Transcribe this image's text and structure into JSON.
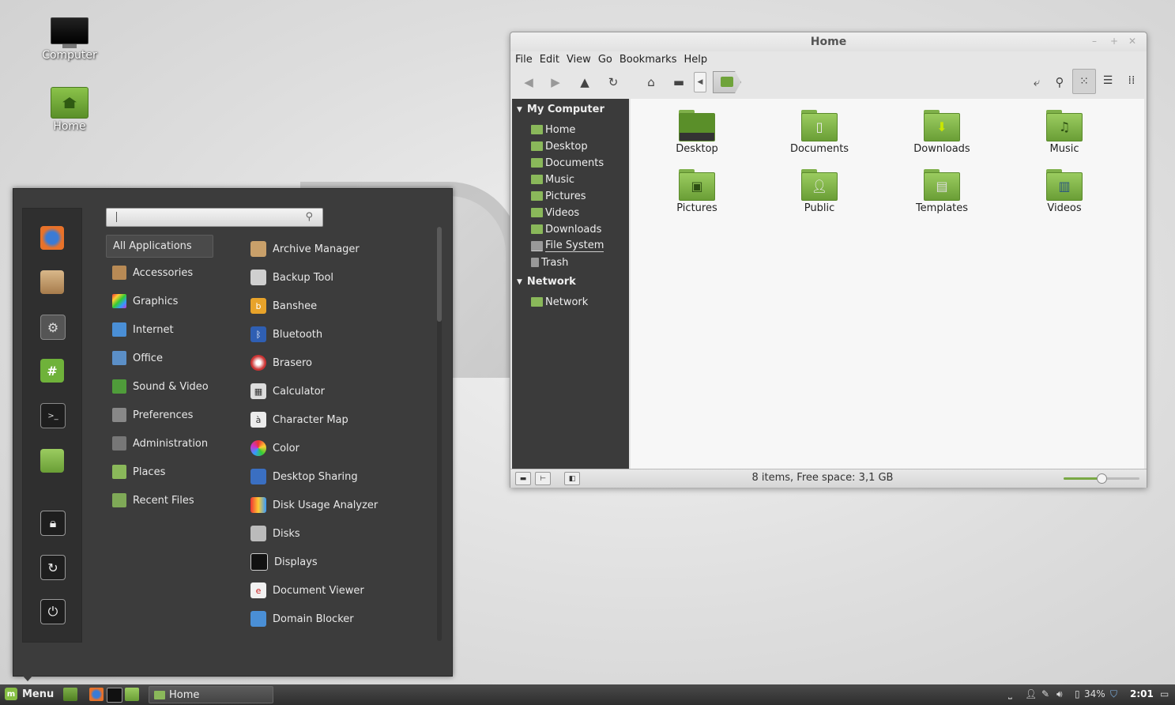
{
  "desktop": {
    "icons": [
      {
        "label": "Computer",
        "icon": "computer-icon"
      },
      {
        "label": "Home",
        "icon": "home-folder-icon"
      }
    ]
  },
  "menu": {
    "search": {
      "value": "",
      "placeholder": ""
    },
    "favorites": [
      "firefox-icon",
      "package-icon",
      "settings-icon",
      "hexchat-icon",
      "terminal-icon",
      "folder-icon",
      "lock-icon",
      "logout-icon",
      "power-icon"
    ],
    "categories": [
      {
        "label": "All Applications",
        "selected": true
      },
      {
        "label": "Accessories"
      },
      {
        "label": "Graphics"
      },
      {
        "label": "Internet"
      },
      {
        "label": "Office"
      },
      {
        "label": "Sound & Video"
      },
      {
        "label": "Preferences"
      },
      {
        "label": "Administration"
      },
      {
        "label": "Places"
      },
      {
        "label": "Recent Files"
      }
    ],
    "apps": [
      "Archive Manager",
      "Backup Tool",
      "Banshee",
      "Bluetooth",
      "Brasero",
      "Calculator",
      "Character Map",
      "Color",
      "Desktop Sharing",
      "Disk Usage Analyzer",
      "Disks",
      "Displays",
      "Document Viewer",
      "Domain Blocker"
    ]
  },
  "window": {
    "title": "Home",
    "menubar": [
      "File",
      "Edit",
      "View",
      "Go",
      "Bookmarks",
      "Help"
    ],
    "sidebar": {
      "my_computer": {
        "heading": "My Computer",
        "items": [
          "Home",
          "Desktop",
          "Documents",
          "Music",
          "Pictures",
          "Videos",
          "Downloads",
          "File System",
          "Trash"
        ]
      },
      "network": {
        "heading": "Network",
        "items": [
          "Network"
        ]
      }
    },
    "files": [
      {
        "name": "Desktop",
        "icon": "desktop-folder-icon"
      },
      {
        "name": "Documents",
        "icon": "documents-folder-icon"
      },
      {
        "name": "Downloads",
        "icon": "downloads-folder-icon"
      },
      {
        "name": "Music",
        "icon": "music-folder-icon"
      },
      {
        "name": "Pictures",
        "icon": "pictures-folder-icon"
      },
      {
        "name": "Public",
        "icon": "public-folder-icon"
      },
      {
        "name": "Templates",
        "icon": "templates-folder-icon"
      },
      {
        "name": "Videos",
        "icon": "videos-folder-icon"
      }
    ],
    "status": "8 items, Free space: 3,1 GB",
    "zoom_level": 0.5
  },
  "panel": {
    "menu_label": "Menu",
    "task_label": "Home",
    "battery": "34%",
    "clock": "2:01"
  },
  "colors": {
    "accent": "#86be43",
    "panel": "#3a3a3a",
    "menu_bg": "#3c3c3c"
  }
}
